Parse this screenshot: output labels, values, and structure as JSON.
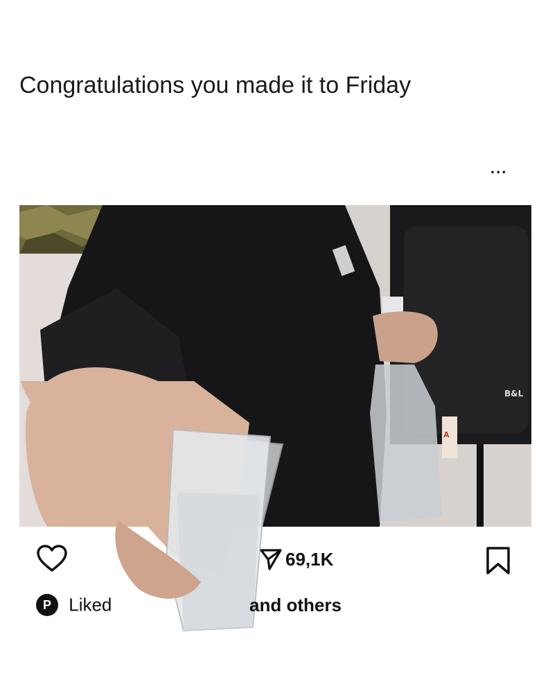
{
  "post": {
    "caption": "Congratulations you made it to Friday",
    "more_label": "...",
    "photo": {
      "speaker_label": "B&L",
      "bottle_label": "A"
    },
    "actions": {
      "share_count": "69,1K"
    },
    "liked_by": {
      "avatar_letter": "P",
      "prefix": "Liked",
      "suffix": "and others"
    }
  }
}
